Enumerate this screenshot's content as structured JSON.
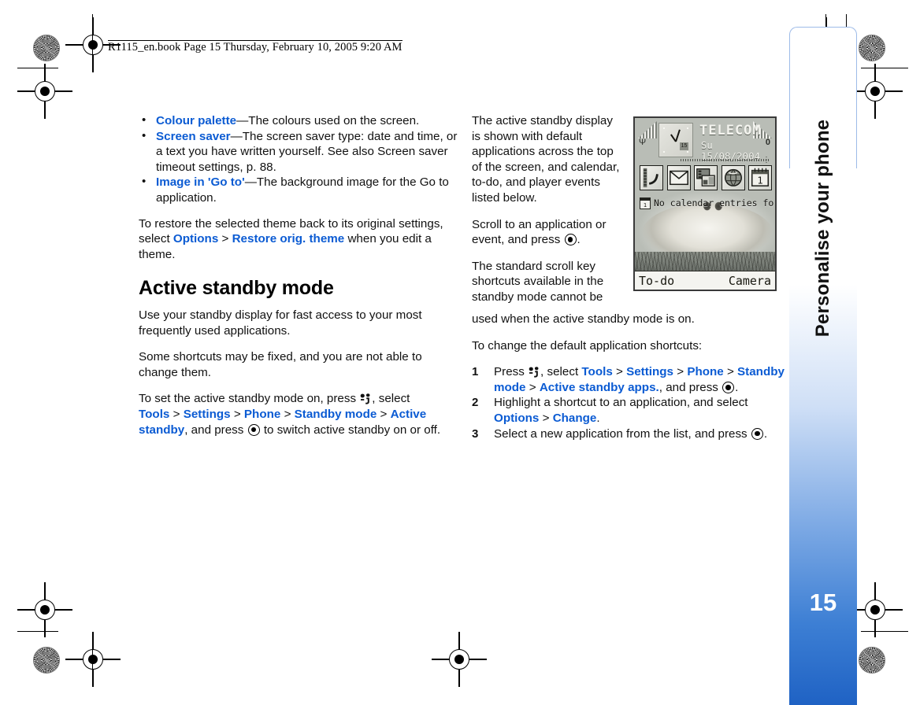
{
  "book_header": "R1115_en.book  Page 15  Thursday, February 10, 2005  9:20 AM",
  "side_tab": {
    "title": "Personalise your phone",
    "page_number": "15"
  },
  "colors": {
    "link_blue": "#0b5bd3",
    "tab_blue": "#1f62c4",
    "tab_frame": "#9dbbe8"
  },
  "left_column": {
    "bullets": [
      {
        "lines": [
          [
            {
              "t": "Colour palette",
              "k": true
            },
            {
              "t": "—The colours used on the screen."
            }
          ]
        ]
      },
      {
        "lines": [
          [
            {
              "t": "Screen saver",
              "k": true
            },
            {
              "t": "—The screen saver type: date and time, or"
            }
          ],
          [
            {
              "t": "a text you have written yourself. See also Screen saver"
            }
          ],
          [
            {
              "t": "timeout settings, p. 88."
            }
          ]
        ]
      },
      {
        "lines": [
          [
            {
              "t": "Image in 'Go to'",
              "k": true
            },
            {
              "t": "—The background image for the Go to"
            }
          ],
          [
            {
              "t": "application."
            }
          ]
        ]
      }
    ],
    "restore_para": [
      [
        {
          "t": "To restore the selected theme back to its original settings,"
        }
      ],
      [
        {
          "t": "select "
        },
        {
          "t": "Options",
          "k": true
        },
        {
          "t": " > "
        },
        {
          "t": "Restore orig. theme",
          "k": true
        },
        {
          "t": " when you edit a"
        }
      ],
      [
        {
          "t": "theme."
        }
      ]
    ],
    "section_heading": "Active standby mode",
    "paragraphs": [
      [
        [
          {
            "t": "Use your standby display for fast access to your most"
          }
        ],
        [
          {
            "t": "frequently used applications."
          }
        ]
      ],
      [
        [
          {
            "t": "Some shortcuts may be fixed, and you are not able to"
          }
        ],
        [
          {
            "t": "change them."
          }
        ]
      ]
    ],
    "set_on_para": {
      "line1_a": "To set the active standby mode on, press ",
      "line1_b": ", select",
      "line2": [
        {
          "t": "Tools",
          "k": true
        },
        {
          "t": " > "
        },
        {
          "t": "Settings",
          "k": true
        },
        {
          "t": " > "
        },
        {
          "t": "Phone",
          "k": true
        },
        {
          "t": " > "
        },
        {
          "t": "Standby mode",
          "k": true
        },
        {
          "t": " > "
        },
        {
          "t": "Active",
          "k": true
        }
      ],
      "line3_a_key": "standby",
      "line3_b": ", and press ",
      "line3_c": " to switch active standby on or off."
    }
  },
  "right_column": {
    "intro": [
      [
        {
          "t": "The active standby display"
        }
      ],
      [
        {
          "t": "is shown with default"
        }
      ],
      [
        {
          "t": "applications across the top"
        }
      ],
      [
        {
          "t": "of the screen, and calendar,"
        }
      ],
      [
        {
          "t": "to-do, and player events"
        }
      ],
      [
        {
          "t": "listed below."
        }
      ]
    ],
    "scroll_para": {
      "line1": "Scroll to an application or",
      "line2_a": "event, and press ",
      "line2_b": "."
    },
    "standard_para": [
      "The standard scroll key",
      "shortcuts available in the",
      "standby mode cannot be",
      "used when the active standby mode is on."
    ],
    "change_intro": "To change the default application shortcuts:",
    "steps": [
      {
        "num": "1",
        "line1_a": "Press ",
        "line1_b": ", select ",
        "line1_keys": [
          {
            "t": "Tools",
            "k": true
          },
          {
            "t": " > "
          },
          {
            "t": "Settings",
            "k": true
          },
          {
            "t": " > "
          },
          {
            "t": "Phone",
            "k": true
          },
          {
            "t": " > "
          },
          {
            "t": "Standby",
            "k": true
          }
        ],
        "line2_keys": [
          {
            "t": "mode",
            "k": true
          },
          {
            "t": " > "
          },
          {
            "t": "Active standby apps.",
            "k": true
          },
          {
            "t": ", and press "
          }
        ],
        "line2_tail": "."
      },
      {
        "num": "2",
        "line1": "Highlight a shortcut to an application, and select",
        "line2_keys": [
          {
            "t": "Options",
            "k": true
          },
          {
            "t": " > "
          },
          {
            "t": "Change",
            "k": true
          },
          {
            "t": "."
          }
        ]
      },
      {
        "num": "3",
        "line1_a": "Select a new application from the list, and press ",
        "line1_b": "."
      }
    ]
  },
  "phone_screenshot": {
    "operator": "TELECOM",
    "date": "Su 15/08/2004",
    "clock_minute_label": "15",
    "battery_label": "0",
    "calendar_note": "No calendar entries for today",
    "calendar_badge_day": "1",
    "app_icons": [
      "contacts-icon",
      "messaging-icon",
      "gallery-icon",
      "web-icon",
      "calendar-icon"
    ],
    "softkey_left": "To-do",
    "softkey_right": "Camera"
  },
  "icons": {
    "scroll_key": "scroll-key-icon",
    "menu_key": "menu-key-icon"
  }
}
